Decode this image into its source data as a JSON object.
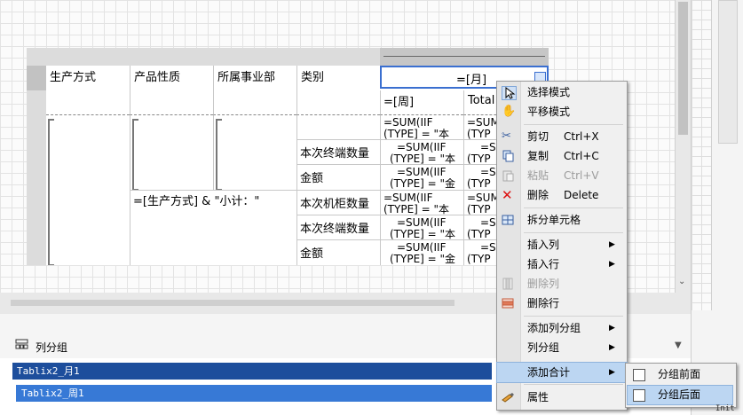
{
  "table": {
    "headers": [
      "生产方式",
      "产品性质",
      "所属事业部",
      "类别"
    ],
    "month_expr": "=[月]",
    "week_expr": "=[周]",
    "total_label": "Total",
    "group_total_expr": "=[生产方式] & \"小计：\"",
    "categories": [
      "本次终端数量",
      "金额",
      "本次机柜数量",
      "本次终端数量",
      "金额"
    ],
    "formula_lines": [
      [
        "=SUM(IIF",
        "(TYPE] = \"本"
      ],
      [
        "=SUM(IIF",
        "(TYPE] = \"本"
      ],
      [
        "=SUM(IIF",
        "(TYPE] = \"金"
      ],
      [
        "=SUM(IIF",
        "(TYPE] = \"本"
      ],
      [
        "=SUM(IIF",
        "(TYPE] = \"本"
      ],
      [
        "=SUM(IIF",
        "(TYPE] = \"金"
      ]
    ],
    "formula_right_lines": [
      [
        "=SUM",
        "(TYP"
      ],
      [
        "=S",
        "(TYP"
      ],
      [
        "=S",
        "(TYP"
      ],
      [
        "=SUM",
        "(TYP"
      ],
      [
        "=S",
        "(TYP"
      ],
      [
        "=S",
        "(TYP"
      ]
    ]
  },
  "context_menu": {
    "items": [
      {
        "label": "选择模式",
        "shortcut": "",
        "icon": "pointer-icon",
        "disabled": false,
        "submenu": false
      },
      {
        "label": "平移模式",
        "shortcut": "",
        "icon": "hand-icon",
        "disabled": false,
        "submenu": false
      },
      {
        "label": "剪切",
        "shortcut": "Ctrl+X",
        "icon": "scissors-icon",
        "disabled": false,
        "submenu": false
      },
      {
        "label": "复制",
        "shortcut": "Ctrl+C",
        "icon": "copy-icon",
        "disabled": false,
        "submenu": false
      },
      {
        "label": "粘贴",
        "shortcut": "Ctrl+V",
        "icon": "paste-icon",
        "disabled": true,
        "submenu": false
      },
      {
        "label": "删除",
        "shortcut": "Delete",
        "icon": "delete-icon",
        "disabled": false,
        "submenu": false
      },
      {
        "label": "拆分单元格",
        "shortcut": "",
        "icon": "split-cell-icon",
        "disabled": false,
        "submenu": false
      },
      {
        "label": "插入列",
        "shortcut": "",
        "icon": "",
        "disabled": false,
        "submenu": true
      },
      {
        "label": "插入行",
        "shortcut": "",
        "icon": "",
        "disabled": false,
        "submenu": true
      },
      {
        "label": "删除列",
        "shortcut": "",
        "icon": "delete-column-icon",
        "disabled": true,
        "submenu": false
      },
      {
        "label": "删除行",
        "shortcut": "",
        "icon": "delete-row-icon",
        "disabled": false,
        "submenu": false
      },
      {
        "label": "添加列分组",
        "shortcut": "",
        "icon": "",
        "disabled": false,
        "submenu": true
      },
      {
        "label": "列分组",
        "shortcut": "",
        "icon": "",
        "disabled": false,
        "submenu": true
      },
      {
        "label": "添加合计",
        "shortcut": "",
        "icon": "",
        "disabled": false,
        "submenu": true
      },
      {
        "label": "属性",
        "shortcut": "",
        "icon": "properties-icon",
        "disabled": false,
        "submenu": false
      }
    ]
  },
  "submenu": {
    "items": [
      {
        "label": "分组前面"
      },
      {
        "label": "分组后面"
      }
    ]
  },
  "groups_panel": {
    "title": "列分组",
    "groups": [
      "Tablix2_月1",
      "Tablix2_周1"
    ]
  },
  "corner_text": "Init",
  "colors": {
    "selected_group": "#1d4e9c",
    "group2": "#3779d6",
    "menu_highlight": "#bcd6f2"
  }
}
